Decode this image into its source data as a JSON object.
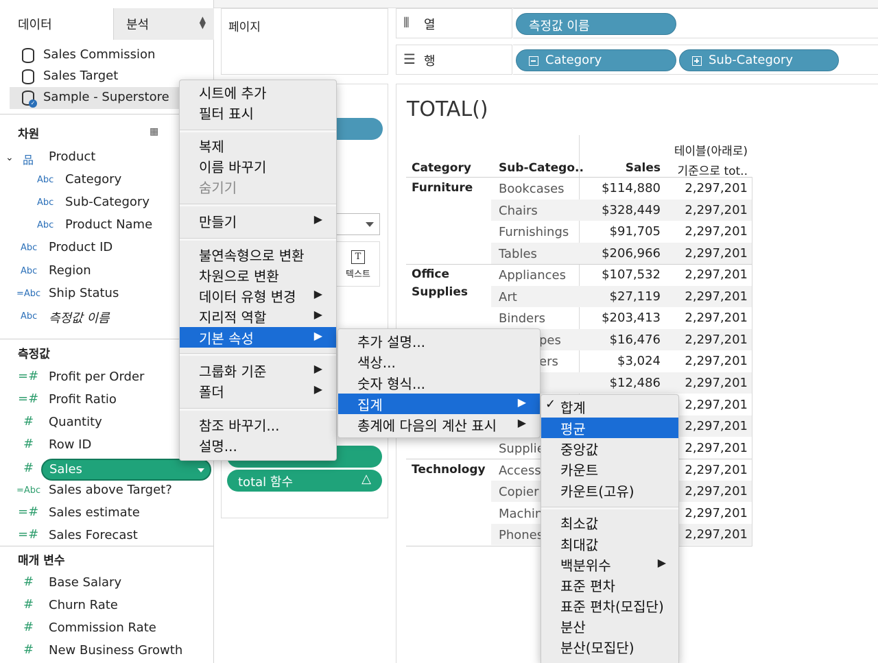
{
  "data_pane": {
    "tab_data": "데이터",
    "tab_analysis": "분석",
    "datasources": [
      "Sales Commission",
      "Sales Target",
      "Sample - Superstore"
    ],
    "dimensions_title": "차원",
    "product_group": "Product",
    "dimensions": [
      {
        "type": "Abc",
        "label": "Category"
      },
      {
        "type": "Abc",
        "label": "Sub-Category"
      },
      {
        "type": "Abc",
        "label": "Product Name"
      },
      {
        "type": "Abc",
        "label": "Product ID"
      },
      {
        "type": "Abc",
        "label": "Region"
      },
      {
        "type": "=Abc",
        "label": "Ship Status"
      },
      {
        "type": "Abc",
        "label": "측정값 이름"
      }
    ],
    "measures_title": "측정값",
    "measures": [
      {
        "type": "=#",
        "label": "Profit per Order"
      },
      {
        "type": "=#",
        "label": "Profit Ratio"
      },
      {
        "type": "#",
        "label": "Quantity"
      },
      {
        "type": "#",
        "label": "Row ID"
      },
      {
        "type": "#",
        "label": "Sales"
      },
      {
        "type": "=Abc",
        "label": "Sales above Target?"
      },
      {
        "type": "=#",
        "label": "Sales estimate"
      },
      {
        "type": "=#",
        "label": "Sales Forecast"
      }
    ],
    "params_title": "매개 변수",
    "params": [
      {
        "type": "#",
        "label": "Base Salary"
      },
      {
        "type": "#",
        "label": "Churn Rate"
      },
      {
        "type": "#",
        "label": "Commission Rate"
      },
      {
        "type": "#",
        "label": "New Business Growth"
      }
    ]
  },
  "pages_label": "페이지",
  "marks": {
    "text_button": "텍스트",
    "text_icon": "T"
  },
  "green_pill_2": "total 함수",
  "columns_shelf": {
    "label": "열",
    "pill": "측정값 이름"
  },
  "rows_shelf": {
    "label": "행",
    "pills": [
      "Category",
      "Sub-Category"
    ]
  },
  "view": {
    "title": "TOTAL()",
    "headers": {
      "category": "Category",
      "subcategory": "Sub-Catego..",
      "sales": "Sales",
      "total_line1": "테이블(아래로)",
      "total_line2": "기준으로 tot.."
    },
    "groups": [
      {
        "name": "Furniture",
        "rows": [
          {
            "sub": "Bookcases",
            "sales": "$114,880",
            "total": "2,297,201"
          },
          {
            "sub": "Chairs",
            "sales": "$328,449",
            "total": "2,297,201"
          },
          {
            "sub": "Furnishings",
            "sales": "$91,705",
            "total": "2,297,201"
          },
          {
            "sub": "Tables",
            "sales": "$206,966",
            "total": "2,297,201"
          }
        ]
      },
      {
        "name": "Office Supplies",
        "name_line1": "Office",
        "name_line2": "Supplies",
        "rows": [
          {
            "sub": "Appliances",
            "sales": "$107,532",
            "total": "2,297,201"
          },
          {
            "sub": "Art",
            "sales": "$27,119",
            "total": "2,297,201"
          },
          {
            "sub": "Binders",
            "sales": "$203,413",
            "total": "2,297,201"
          },
          {
            "sub": "pes",
            "sales": "$16,476",
            "total": "2,297,201"
          },
          {
            "sub": "ers",
            "sales": "$3,024",
            "total": "2,297,201"
          },
          {
            "sub": "",
            "sales": "$12,486",
            "total": "2,297,201"
          },
          {
            "sub": "",
            "sales": "",
            "total": "2,297,201"
          },
          {
            "sub": "",
            "sales": "",
            "total": "2,297,201"
          },
          {
            "sub": "Supplie",
            "sales": "",
            "total": "2,297,201"
          }
        ]
      },
      {
        "name": "Technology",
        "rows": [
          {
            "sub": "Access",
            "sales": "",
            "total": "2,297,201"
          },
          {
            "sub": "Copier",
            "sales": "",
            "total": "2,297,201"
          },
          {
            "sub": "Machin",
            "sales": "",
            "total": "2,297,201"
          },
          {
            "sub": "Phones",
            "sales": "",
            "total": "2,297,201"
          }
        ]
      }
    ]
  },
  "context_menu": {
    "items": [
      "시트에 추가",
      "필터 표시",
      "복제",
      "이름 바꾸기",
      "숨기기",
      "만들기",
      "불연속형으로 변환",
      "차원으로 변환",
      "데이터 유형 변경",
      "지리적 역할",
      "기본 속성",
      "그룹화 기준",
      "폴더",
      "참조 바꾸기...",
      "설명..."
    ]
  },
  "submenu_default_props": {
    "items": [
      "추가 설명...",
      "색상...",
      "숫자 형식...",
      "집계",
      "총계에 다음의 계산 표시"
    ]
  },
  "submenu_aggregation": {
    "items": [
      "합계",
      "평균",
      "중앙값",
      "카운트",
      "카운트(고유)",
      "최소값",
      "최대값",
      "백분위수",
      "표준 편차",
      "표준 편차(모집단)",
      "분산",
      "분산(모집단)"
    ],
    "checked_mark": "✓"
  },
  "colors": {
    "accent_blue": "#1a6dd6",
    "pill_blue": "#4a97b7",
    "pill_green": "#1fa37a"
  }
}
